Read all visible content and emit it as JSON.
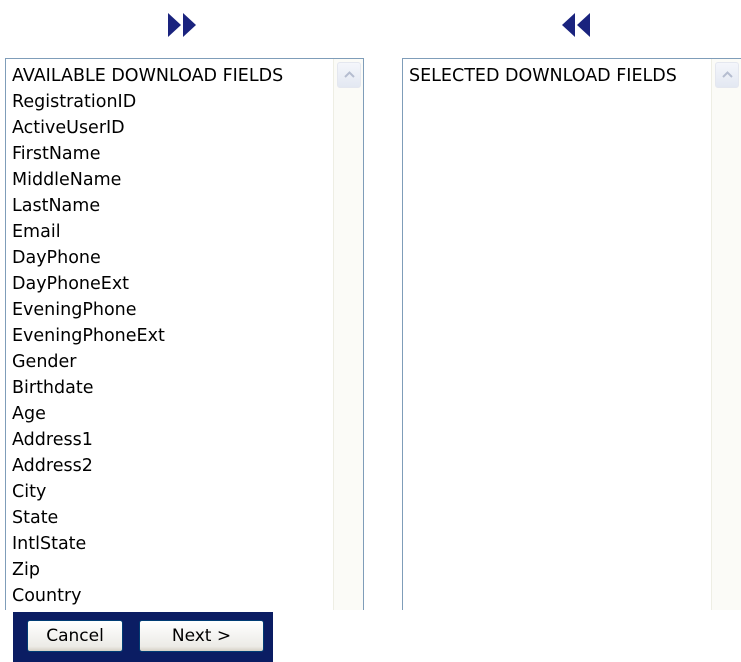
{
  "toolbar": {
    "move_right_icon": "double-chevron-right-icon",
    "move_left_icon": "double-chevron-left-icon",
    "arrow_color": "#1a237e"
  },
  "available": {
    "header": "AVAILABLE DOWNLOAD FIELDS",
    "items": [
      "RegistrationID",
      "ActiveUserID",
      "FirstName",
      "MiddleName",
      "LastName",
      "Email",
      "DayPhone",
      "DayPhoneExt",
      "EveningPhone",
      "EveningPhoneExt",
      "Gender",
      "Birthdate",
      "Age",
      "Address1",
      "Address2",
      "City",
      "State",
      "IntlState",
      "Zip",
      "Country"
    ]
  },
  "selected": {
    "header": "SELECTED DOWNLOAD FIELDS",
    "items": []
  },
  "buttons": {
    "cancel": "Cancel",
    "next": "Next >"
  },
  "colors": {
    "button_bar_bg": "#0b1d63",
    "listbox_border": "#7f9db9"
  }
}
